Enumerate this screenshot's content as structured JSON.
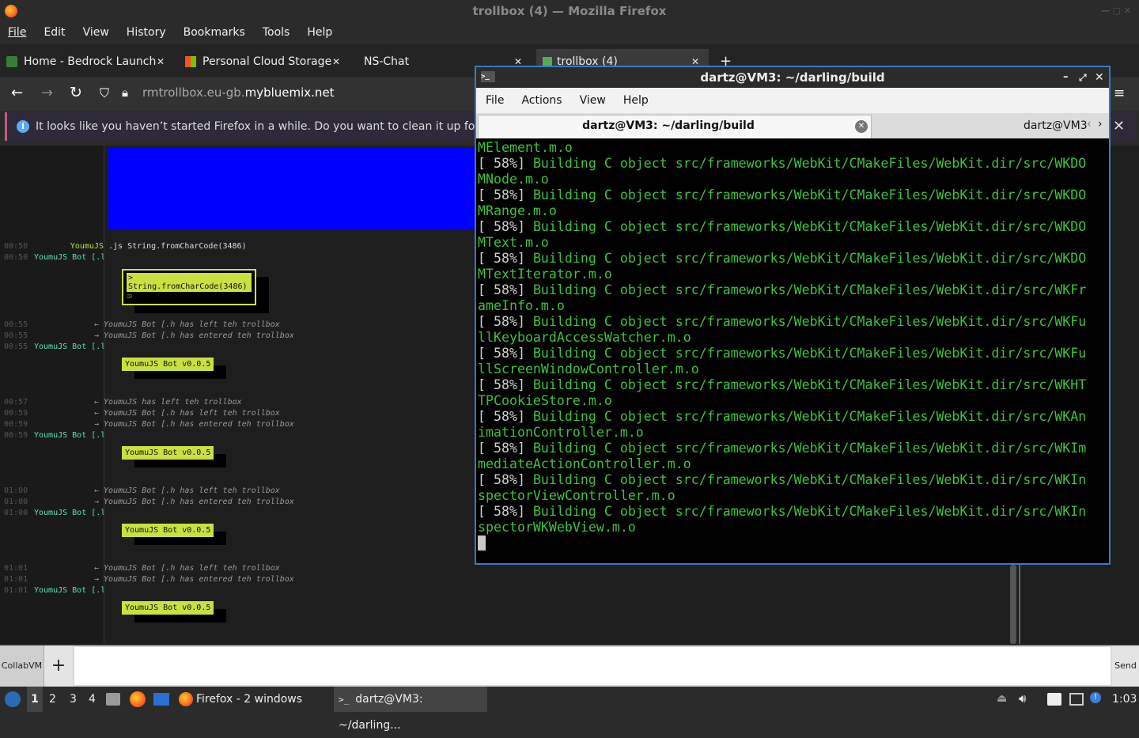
{
  "window": {
    "title": "trollbox (4) — Mozilla Firefox"
  },
  "menubar": [
    "File",
    "Edit",
    "View",
    "History",
    "Bookmarks",
    "Tools",
    "Help"
  ],
  "tabs": [
    {
      "label": "Home - Bedrock Launche"
    },
    {
      "label": "Personal Cloud Storage -"
    },
    {
      "label": "NS-Chat"
    },
    {
      "label": "trollbox (4)"
    }
  ],
  "new_tab": "+",
  "urlbar": {
    "host_prefix": "rmtrollbox.eu-gb.",
    "host_domain": "mybluemix.net"
  },
  "notice": {
    "text": "It looks like you haven’t started Firefox in a while. Do you want to clean it up for a f"
  },
  "chat": {
    "lines": [
      {
        "time": "00:50",
        "user": "YoumuJS",
        "text": ".js String.fromCharCode(3486)"
      },
      {
        "time": "00:50",
        "user": "YoumuJS Bot [.l",
        "text": ""
      },
      {
        "time": "00:55",
        "user": "",
        "text": "← YoumuJS Bot [.h has left teh trollbox"
      },
      {
        "time": "00:55",
        "user": "",
        "text": "→ YoumuJS Bot [.h has entered teh trollbox"
      },
      {
        "time": "00:55",
        "user": "YoumuJS Bot [.l",
        "text": ""
      },
      {
        "time": "00:57",
        "user": "",
        "text": "← YoumuJS has left teh trollbox"
      },
      {
        "time": "00:59",
        "user": "",
        "text": "← YoumuJS Bot [.h has left teh trollbox"
      },
      {
        "time": "00:59",
        "user": "",
        "text": "→ YoumuJS Bot [.h has entered teh trollbox"
      },
      {
        "time": "00:59",
        "user": "YoumuJS Bot [.l",
        "text": ""
      },
      {
        "time": "01:00",
        "user": "",
        "text": "← YoumuJS Bot [.h has left teh trollbox"
      },
      {
        "time": "01:00",
        "user": "",
        "text": "→ YoumuJS Bot [.h has entered teh trollbox"
      },
      {
        "time": "01:00",
        "user": "YoumuJS Bot [.l",
        "text": ""
      },
      {
        "time": "01:01",
        "user": "",
        "text": "← YoumuJS Bot [.h has left teh trollbox"
      },
      {
        "time": "01:01",
        "user": "",
        "text": "→ YoumuJS Bot [.h has entered teh trollbox"
      },
      {
        "time": "01:01",
        "user": "YoumuJS Bot [.l",
        "text": ""
      }
    ],
    "eval_box": "> String.fromCharCode(3486)",
    "bot_box": "YoumuJS Bot v0.0.5"
  },
  "collab": {
    "label": "CollabVM",
    "add": "+",
    "send": "Send"
  },
  "terminal": {
    "title": "dartz@VM3: ~/darling/build",
    "menu": [
      "File",
      "Actions",
      "View",
      "Help"
    ],
    "tab_active": "dartz@VM3: ~/darling/build",
    "tab_other": "dartz@VM3",
    "lines": [
      {
        "p": "",
        "t": "MElement.m.o"
      },
      {
        "p": "[ 58%] ",
        "t": "Building C object src/frameworks/WebKit/CMakeFiles/WebKit.dir/src/WKDO"
      },
      {
        "p": "",
        "t": "MNode.m.o"
      },
      {
        "p": "[ 58%] ",
        "t": "Building C object src/frameworks/WebKit/CMakeFiles/WebKit.dir/src/WKDO"
      },
      {
        "p": "",
        "t": "MRange.m.o"
      },
      {
        "p": "[ 58%] ",
        "t": "Building C object src/frameworks/WebKit/CMakeFiles/WebKit.dir/src/WKDO"
      },
      {
        "p": "",
        "t": "MText.m.o"
      },
      {
        "p": "[ 58%] ",
        "t": "Building C object src/frameworks/WebKit/CMakeFiles/WebKit.dir/src/WKDO"
      },
      {
        "p": "",
        "t": "MTextIterator.m.o"
      },
      {
        "p": "[ 58%] ",
        "t": "Building C object src/frameworks/WebKit/CMakeFiles/WebKit.dir/src/WKFr"
      },
      {
        "p": "",
        "t": "ameInfo.m.o"
      },
      {
        "p": "[ 58%] ",
        "t": "Building C object src/frameworks/WebKit/CMakeFiles/WebKit.dir/src/WKFu"
      },
      {
        "p": "",
        "t": "llKeyboardAccessWatcher.m.o"
      },
      {
        "p": "[ 58%] ",
        "t": "Building C object src/frameworks/WebKit/CMakeFiles/WebKit.dir/src/WKFu"
      },
      {
        "p": "",
        "t": "llScreenWindowController.m.o"
      },
      {
        "p": "[ 58%] ",
        "t": "Building C object src/frameworks/WebKit/CMakeFiles/WebKit.dir/src/WKHT"
      },
      {
        "p": "",
        "t": "TPCookieStore.m.o"
      },
      {
        "p": "[ 58%] ",
        "t": "Building C object src/frameworks/WebKit/CMakeFiles/WebKit.dir/src/WKAn"
      },
      {
        "p": "",
        "t": "imationController.m.o"
      },
      {
        "p": "[ 58%] ",
        "t": "Building C object src/frameworks/WebKit/CMakeFiles/WebKit.dir/src/WKIm"
      },
      {
        "p": "",
        "t": "mediateActionController.m.o"
      },
      {
        "p": "[ 58%] ",
        "t": "Building C object src/frameworks/WebKit/CMakeFiles/WebKit.dir/src/WKIn"
      },
      {
        "p": "",
        "t": "spectorViewController.m.o"
      },
      {
        "p": "[ 58%] ",
        "t": "Building C object src/frameworks/WebKit/CMakeFiles/WebKit.dir/src/WKIn"
      },
      {
        "p": "",
        "t": "spectorWKWebView.m.o"
      }
    ]
  },
  "taskbar": {
    "workspaces": [
      "1",
      "2",
      "3",
      "4"
    ],
    "firefox_task": "Firefox - 2 windows",
    "terminal_task": "dartz@VM3: ~/darling...",
    "clock": "1:03"
  }
}
